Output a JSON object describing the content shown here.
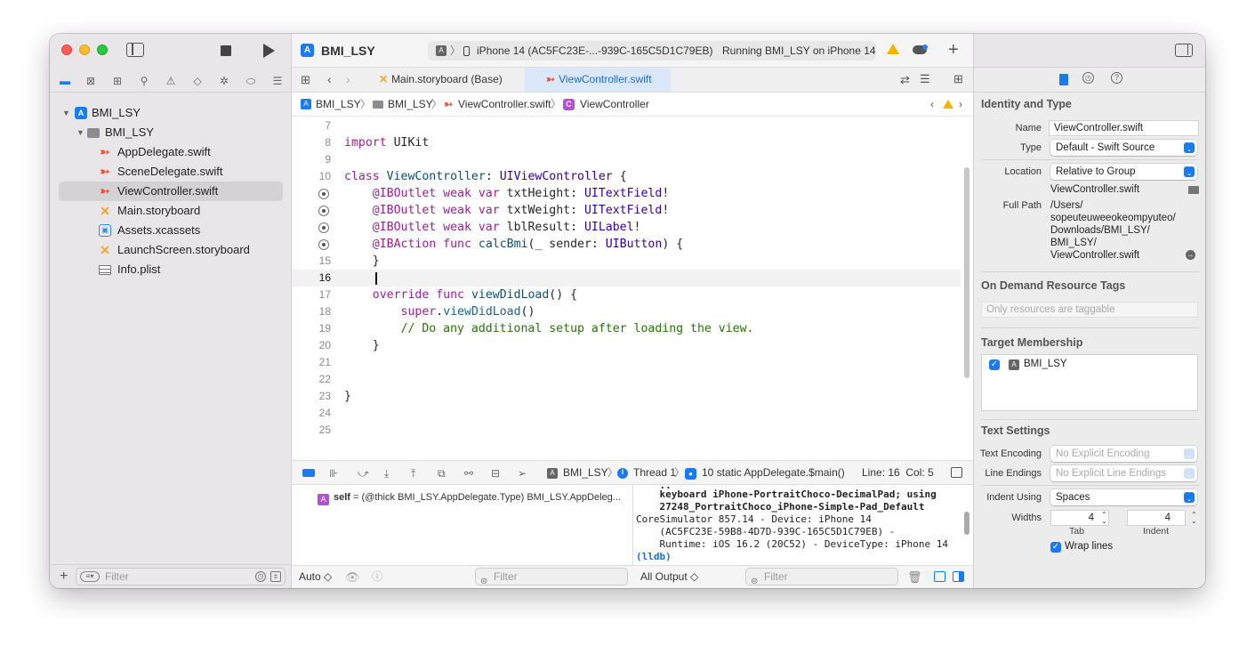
{
  "toolbar": {
    "project_name": "BMI_LSY",
    "status_device": "iPhone 14 (AC5FC23E-...-939C-165C5D1C79EB)",
    "status_text": "Running BMI_LSY on iPhone 14",
    "add_label": "+"
  },
  "navigator": {
    "items": [
      {
        "label": "BMI_LSY",
        "icon": "app-project-icon"
      },
      {
        "label": "BMI_LSY",
        "icon": "folder-icon"
      },
      {
        "label": "AppDelegate.swift",
        "icon": "swift-file-icon"
      },
      {
        "label": "SceneDelegate.swift",
        "icon": "swift-file-icon"
      },
      {
        "label": "ViewController.swift",
        "icon": "swift-file-icon",
        "selected": true
      },
      {
        "label": "Main.storyboard",
        "icon": "storyboard-icon"
      },
      {
        "label": "Assets.xcassets",
        "icon": "asset-catalog-icon"
      },
      {
        "label": "LaunchScreen.storyboard",
        "icon": "storyboard-icon"
      },
      {
        "label": "Info.plist",
        "icon": "plist-icon"
      }
    ],
    "filter_placeholder": "Filter"
  },
  "tabs": [
    {
      "label": "Main.storyboard (Base)"
    },
    {
      "label": "ViewController.swift",
      "active": true
    }
  ],
  "breadcrumb": [
    "BMI_LSY",
    "BMI_LSY",
    "ViewController.swift",
    "ViewController"
  ],
  "editor": {
    "current_line": "16",
    "lines": [
      {
        "n": "7",
        "text": ""
      },
      {
        "n": "8",
        "text": "import UIKit"
      },
      {
        "n": "9",
        "text": ""
      },
      {
        "n": "10",
        "text": "class ViewController: UIViewController {"
      },
      {
        "n": "11",
        "text": "    @IBOutlet weak var txtHeight: UITextField!"
      },
      {
        "n": "12",
        "text": "    @IBOutlet weak var txtWeight: UITextField!"
      },
      {
        "n": "13",
        "text": "    @IBOutlet weak var lblResult: UILabel!"
      },
      {
        "n": "14",
        "text": "    @IBAction func calcBmi(_ sender: UIButton) {"
      },
      {
        "n": "15",
        "text": "    }"
      },
      {
        "n": "16",
        "text": ""
      },
      {
        "n": "17",
        "text": "    override func viewDidLoad() {"
      },
      {
        "n": "18",
        "text": "        super.viewDidLoad()"
      },
      {
        "n": "19",
        "text": "        // Do any additional setup after loading the view."
      },
      {
        "n": "20",
        "text": "    }"
      },
      {
        "n": "21",
        "text": ""
      },
      {
        "n": "22",
        "text": ""
      },
      {
        "n": "23",
        "text": "}"
      },
      {
        "n": "24",
        "text": ""
      },
      {
        "n": "25",
        "text": ""
      }
    ]
  },
  "debug_bar": {
    "target": "BMI_LSY",
    "thread": "Thread 1",
    "frame": "10 static AppDelegate.$main()",
    "position": "Line: 16  Col: 5"
  },
  "variables": {
    "badge": "A",
    "name": "self",
    "value": "= (@thick BMI_LSY.AppDelegate.Type) BMI_LSY.AppDeleg..."
  },
  "console": {
    "lines": [
      "    keyboard iPhone-PortraitChoco-DecimalPad; using",
      "    27248_PortraitChoco_iPhone-Simple-Pad_Default",
      "CoreSimulator 857.14 - Device: iPhone 14",
      "    (AC5FC23E-59B8-4D7D-939C-165C5D1C79EB) -",
      "    Runtime: iOS 16.2 (20C52) - DeviceType: iPhone 14"
    ],
    "prompt": "(lldb)"
  },
  "debug_footer": {
    "auto_label": "Auto ◇",
    "filter_placeholder": "Filter",
    "output_label": "All Output ◇",
    "filter2_placeholder": "Filter"
  },
  "inspector": {
    "identity_title": "Identity and Type",
    "name_label": "Name",
    "name_value": "ViewController.swift",
    "type_label": "Type",
    "type_value": "Default - Swift Source",
    "location_label": "Location",
    "location_value": "Relative to Group",
    "location_file": "ViewController.swift",
    "fullpath_label": "Full Path",
    "fullpath_lines": [
      "/Users/",
      "sopeuteuweeokeompyuteo/",
      "Downloads/BMI_LSY/",
      "BMI_LSY/",
      "ViewController.swift"
    ],
    "ondemand_title": "On Demand Resource Tags",
    "ondemand_placeholder": "Only resources are taggable",
    "target_title": "Target Membership",
    "target_item": "BMI_LSY",
    "text_settings_title": "Text Settings",
    "encoding_label": "Text Encoding",
    "encoding_value": "No Explicit Encoding",
    "line_endings_label": "Line Endings",
    "line_endings_value": "No Explicit Line Endings",
    "indent_using_label": "Indent Using",
    "indent_using_value": "Spaces",
    "widths_label": "Widths",
    "tab_value": "4",
    "indent_value": "4",
    "tab_label": "Tab",
    "indent_label": "Indent",
    "wrap_label": "Wrap lines"
  },
  "colors": {
    "accent": "#1a7bf0",
    "keyword": "#9b2393",
    "type": "#3900a0",
    "comment": "#267507",
    "swift": "#f05138",
    "storyboard": "#f5a623"
  }
}
